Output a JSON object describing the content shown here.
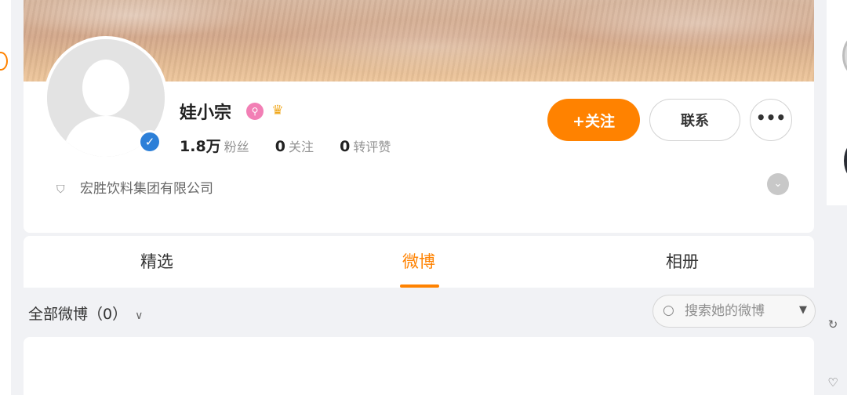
{
  "profile": {
    "username": "娃小宗",
    "verified": true,
    "company": "宏胜饮料集团有限公司",
    "stats": [
      {
        "num": "1.8万",
        "label": "粉丝"
      },
      {
        "num": "0",
        "label": "关注"
      },
      {
        "num": "0",
        "label": "转评赞"
      }
    ]
  },
  "actions": {
    "follow_label": "+关注",
    "contact_label": "联系",
    "more_label": "•••"
  },
  "tabs": [
    {
      "label": "精选",
      "active": false
    },
    {
      "label": "微博",
      "active": true
    },
    {
      "label": "相册",
      "active": false
    }
  ],
  "filter": {
    "label": "全部微博（0）",
    "search_placeholder": "搜索她的微博"
  },
  "icons": {
    "verified": "verified-icon",
    "member": "member-icon",
    "crown": "crown-icon",
    "shield": "shield-icon",
    "expand": "chevron-down-icon",
    "search": "search-icon"
  },
  "colors": {
    "accent": "#ff8200",
    "verified": "#2c7fd8",
    "background": "#f1f2f5"
  }
}
